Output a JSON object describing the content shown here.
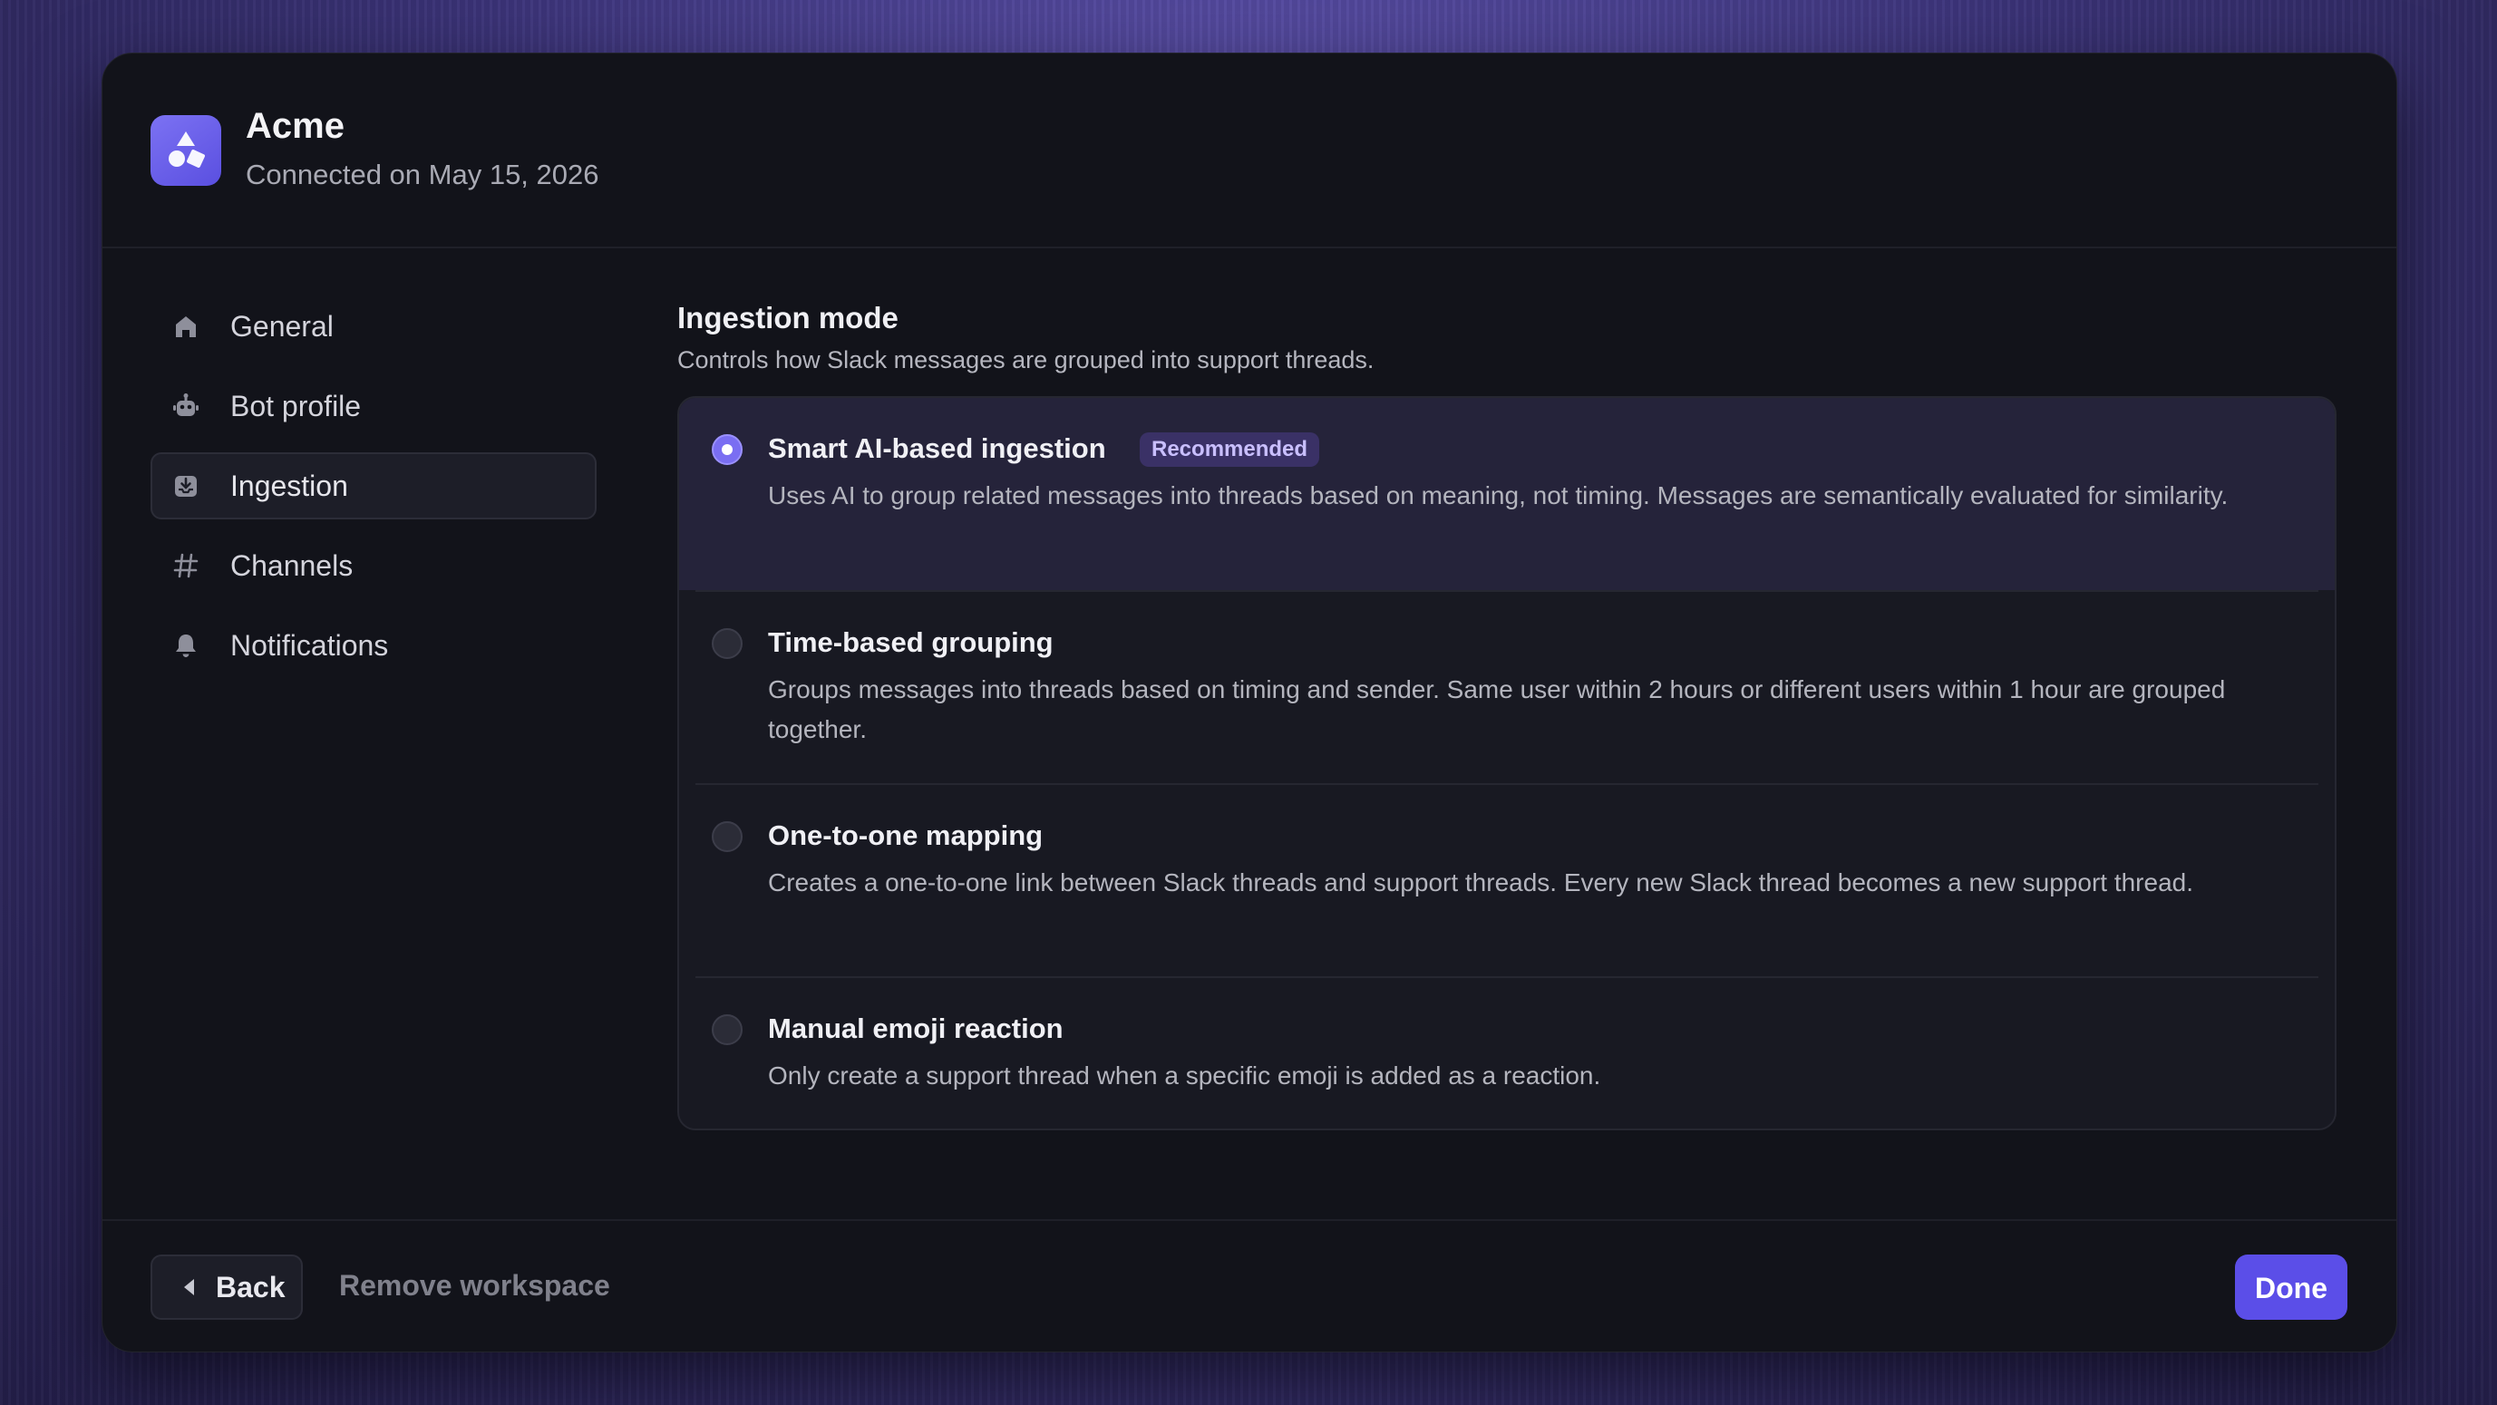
{
  "header": {
    "app_name": "Acme",
    "connected_text": "Connected on May 15, 2026",
    "logo_icon": "shapes-logo-icon"
  },
  "sidebar": {
    "items": [
      {
        "label": "General",
        "icon": "home-icon",
        "active": false
      },
      {
        "label": "Bot profile",
        "icon": "bot-icon",
        "active": false
      },
      {
        "label": "Ingestion",
        "icon": "ingest-icon",
        "active": true
      },
      {
        "label": "Channels",
        "icon": "hash-icon",
        "active": false
      },
      {
        "label": "Notifications",
        "icon": "bell-icon",
        "active": false
      }
    ]
  },
  "main": {
    "title": "Ingestion mode",
    "description": "Controls how Slack messages are grouped into support threads.",
    "options": [
      {
        "title": "Smart AI-based ingestion",
        "badge": "Recommended",
        "description": "Uses AI to group related messages into threads based on meaning, not timing. Messages are semantically evaluated for similarity.",
        "selected": true
      },
      {
        "title": "Time-based grouping",
        "description": "Groups messages into threads based on timing and sender. Same user within 2 hours or different users within 1 hour are grouped together.",
        "selected": false
      },
      {
        "title": "One-to-one mapping",
        "description": "Creates a one-to-one link between Slack threads and support threads. Every new Slack thread becomes a new support thread.",
        "selected": false
      },
      {
        "title": "Manual emoji reaction",
        "description": "Only create a support thread when a specific emoji is added as a reaction.",
        "selected": false
      }
    ]
  },
  "footer": {
    "back_label": "Back",
    "remove_label": "Remove workspace",
    "done_label": "Done"
  },
  "colors": {
    "accent": "#5b4ee8",
    "radio_selected": "#7a6ef2",
    "badge_bg": "#3a3166",
    "dialog_bg": "#12131a"
  }
}
